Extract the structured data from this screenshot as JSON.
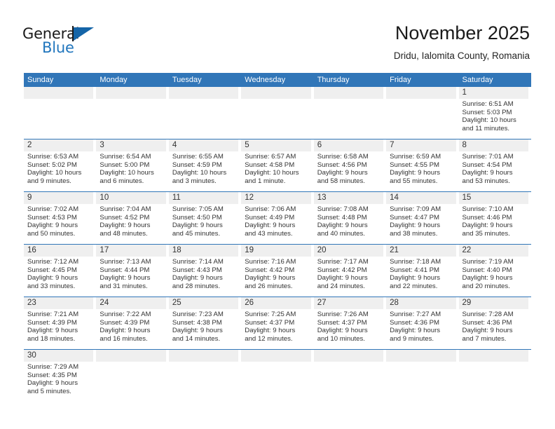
{
  "brand": {
    "line1": "General",
    "line2": "Blue",
    "flag_color": "#1565a8",
    "blue_text_color": "#2176bd"
  },
  "header": {
    "title": "November 2025",
    "subtitle": "Dridu, Ialomita County, Romania"
  },
  "theme": {
    "header_blue": "#3176b8",
    "day_band_gray": "#efefef",
    "text_color": "#333333"
  },
  "weekdays": [
    "Sunday",
    "Monday",
    "Tuesday",
    "Wednesday",
    "Thursday",
    "Friday",
    "Saturday"
  ],
  "weeks": [
    [
      {
        "empty": true
      },
      {
        "empty": true
      },
      {
        "empty": true
      },
      {
        "empty": true
      },
      {
        "empty": true
      },
      {
        "empty": true
      },
      {
        "day": "1",
        "sunrise": "Sunrise: 6:51 AM",
        "sunset": "Sunset: 5:03 PM",
        "daylight1": "Daylight: 10 hours",
        "daylight2": "and 11 minutes."
      }
    ],
    [
      {
        "day": "2",
        "sunrise": "Sunrise: 6:53 AM",
        "sunset": "Sunset: 5:02 PM",
        "daylight1": "Daylight: 10 hours",
        "daylight2": "and 9 minutes."
      },
      {
        "day": "3",
        "sunrise": "Sunrise: 6:54 AM",
        "sunset": "Sunset: 5:00 PM",
        "daylight1": "Daylight: 10 hours",
        "daylight2": "and 6 minutes."
      },
      {
        "day": "4",
        "sunrise": "Sunrise: 6:55 AM",
        "sunset": "Sunset: 4:59 PM",
        "daylight1": "Daylight: 10 hours",
        "daylight2": "and 3 minutes."
      },
      {
        "day": "5",
        "sunrise": "Sunrise: 6:57 AM",
        "sunset": "Sunset: 4:58 PM",
        "daylight1": "Daylight: 10 hours",
        "daylight2": "and 1 minute."
      },
      {
        "day": "6",
        "sunrise": "Sunrise: 6:58 AM",
        "sunset": "Sunset: 4:56 PM",
        "daylight1": "Daylight: 9 hours",
        "daylight2": "and 58 minutes."
      },
      {
        "day": "7",
        "sunrise": "Sunrise: 6:59 AM",
        "sunset": "Sunset: 4:55 PM",
        "daylight1": "Daylight: 9 hours",
        "daylight2": "and 55 minutes."
      },
      {
        "day": "8",
        "sunrise": "Sunrise: 7:01 AM",
        "sunset": "Sunset: 4:54 PM",
        "daylight1": "Daylight: 9 hours",
        "daylight2": "and 53 minutes."
      }
    ],
    [
      {
        "day": "9",
        "sunrise": "Sunrise: 7:02 AM",
        "sunset": "Sunset: 4:53 PM",
        "daylight1": "Daylight: 9 hours",
        "daylight2": "and 50 minutes."
      },
      {
        "day": "10",
        "sunrise": "Sunrise: 7:04 AM",
        "sunset": "Sunset: 4:52 PM",
        "daylight1": "Daylight: 9 hours",
        "daylight2": "and 48 minutes."
      },
      {
        "day": "11",
        "sunrise": "Sunrise: 7:05 AM",
        "sunset": "Sunset: 4:50 PM",
        "daylight1": "Daylight: 9 hours",
        "daylight2": "and 45 minutes."
      },
      {
        "day": "12",
        "sunrise": "Sunrise: 7:06 AM",
        "sunset": "Sunset: 4:49 PM",
        "daylight1": "Daylight: 9 hours",
        "daylight2": "and 43 minutes."
      },
      {
        "day": "13",
        "sunrise": "Sunrise: 7:08 AM",
        "sunset": "Sunset: 4:48 PM",
        "daylight1": "Daylight: 9 hours",
        "daylight2": "and 40 minutes."
      },
      {
        "day": "14",
        "sunrise": "Sunrise: 7:09 AM",
        "sunset": "Sunset: 4:47 PM",
        "daylight1": "Daylight: 9 hours",
        "daylight2": "and 38 minutes."
      },
      {
        "day": "15",
        "sunrise": "Sunrise: 7:10 AM",
        "sunset": "Sunset: 4:46 PM",
        "daylight1": "Daylight: 9 hours",
        "daylight2": "and 35 minutes."
      }
    ],
    [
      {
        "day": "16",
        "sunrise": "Sunrise: 7:12 AM",
        "sunset": "Sunset: 4:45 PM",
        "daylight1": "Daylight: 9 hours",
        "daylight2": "and 33 minutes."
      },
      {
        "day": "17",
        "sunrise": "Sunrise: 7:13 AM",
        "sunset": "Sunset: 4:44 PM",
        "daylight1": "Daylight: 9 hours",
        "daylight2": "and 31 minutes."
      },
      {
        "day": "18",
        "sunrise": "Sunrise: 7:14 AM",
        "sunset": "Sunset: 4:43 PM",
        "daylight1": "Daylight: 9 hours",
        "daylight2": "and 28 minutes."
      },
      {
        "day": "19",
        "sunrise": "Sunrise: 7:16 AM",
        "sunset": "Sunset: 4:42 PM",
        "daylight1": "Daylight: 9 hours",
        "daylight2": "and 26 minutes."
      },
      {
        "day": "20",
        "sunrise": "Sunrise: 7:17 AM",
        "sunset": "Sunset: 4:42 PM",
        "daylight1": "Daylight: 9 hours",
        "daylight2": "and 24 minutes."
      },
      {
        "day": "21",
        "sunrise": "Sunrise: 7:18 AM",
        "sunset": "Sunset: 4:41 PM",
        "daylight1": "Daylight: 9 hours",
        "daylight2": "and 22 minutes."
      },
      {
        "day": "22",
        "sunrise": "Sunrise: 7:19 AM",
        "sunset": "Sunset: 4:40 PM",
        "daylight1": "Daylight: 9 hours",
        "daylight2": "and 20 minutes."
      }
    ],
    [
      {
        "day": "23",
        "sunrise": "Sunrise: 7:21 AM",
        "sunset": "Sunset: 4:39 PM",
        "daylight1": "Daylight: 9 hours",
        "daylight2": "and 18 minutes."
      },
      {
        "day": "24",
        "sunrise": "Sunrise: 7:22 AM",
        "sunset": "Sunset: 4:39 PM",
        "daylight1": "Daylight: 9 hours",
        "daylight2": "and 16 minutes."
      },
      {
        "day": "25",
        "sunrise": "Sunrise: 7:23 AM",
        "sunset": "Sunset: 4:38 PM",
        "daylight1": "Daylight: 9 hours",
        "daylight2": "and 14 minutes."
      },
      {
        "day": "26",
        "sunrise": "Sunrise: 7:25 AM",
        "sunset": "Sunset: 4:37 PM",
        "daylight1": "Daylight: 9 hours",
        "daylight2": "and 12 minutes."
      },
      {
        "day": "27",
        "sunrise": "Sunrise: 7:26 AM",
        "sunset": "Sunset: 4:37 PM",
        "daylight1": "Daylight: 9 hours",
        "daylight2": "and 10 minutes."
      },
      {
        "day": "28",
        "sunrise": "Sunrise: 7:27 AM",
        "sunset": "Sunset: 4:36 PM",
        "daylight1": "Daylight: 9 hours",
        "daylight2": "and 9 minutes."
      },
      {
        "day": "29",
        "sunrise": "Sunrise: 7:28 AM",
        "sunset": "Sunset: 4:36 PM",
        "daylight1": "Daylight: 9 hours",
        "daylight2": "and 7 minutes."
      }
    ],
    [
      {
        "day": "30",
        "sunrise": "Sunrise: 7:29 AM",
        "sunset": "Sunset: 4:35 PM",
        "daylight1": "Daylight: 9 hours",
        "daylight2": "and 5 minutes."
      },
      {
        "empty": true
      },
      {
        "empty": true
      },
      {
        "empty": true
      },
      {
        "empty": true
      },
      {
        "empty": true
      },
      {
        "empty": true
      }
    ]
  ]
}
